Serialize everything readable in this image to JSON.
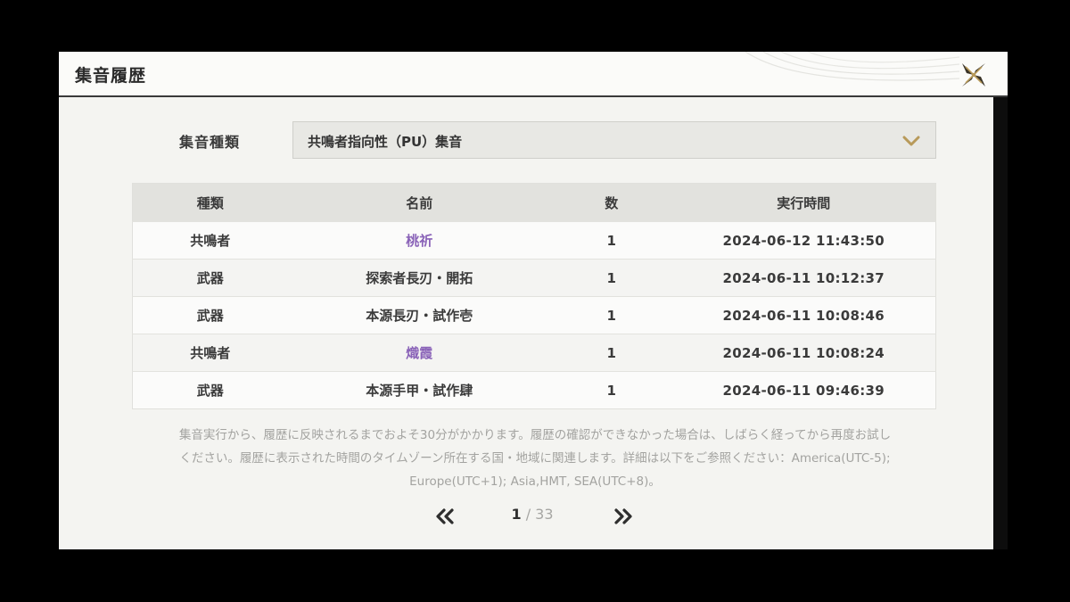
{
  "header": {
    "title": "集音履歴",
    "close_icon": "close-x-icon"
  },
  "filter": {
    "label": "集音種類",
    "selected": "共鳴者指向性（PU）集音",
    "chevron_icon": "chevron-down-icon",
    "chevron_color": "#b89a5a"
  },
  "table": {
    "headers": {
      "type": "種類",
      "name": "名前",
      "count": "数",
      "time": "実行時間"
    },
    "rows": [
      {
        "type": "共鳴者",
        "name": "桃祈",
        "count": "1",
        "time": "2024-06-12 11:43:50",
        "highlight": true
      },
      {
        "type": "武器",
        "name": "探索者長刃・開拓",
        "count": "1",
        "time": "2024-06-11 10:12:37",
        "highlight": false
      },
      {
        "type": "武器",
        "name": "本源長刃・試作壱",
        "count": "1",
        "time": "2024-06-11 10:08:46",
        "highlight": false
      },
      {
        "type": "共鳴者",
        "name": "熾霞",
        "count": "1",
        "time": "2024-06-11 10:08:24",
        "highlight": true
      },
      {
        "type": "武器",
        "name": "本源手甲・試作肆",
        "count": "1",
        "time": "2024-06-11 09:46:39",
        "highlight": false
      }
    ],
    "highlight_color": "#8a63b8"
  },
  "notice": {
    "line1": "集音実行から、履歴に反映されるまでおよそ30分がかかります。履歴の確認ができなかった場合は、しばらく経ってから再度お試し",
    "line2": "ください。履歴に表示された時間のタイムゾーン所在する国・地域に関連します。詳細は以下をご参照ください：America(UTC-5);",
    "line3": "Europe(UTC+1); Asia,HMT, SEA(UTC+8)。"
  },
  "pager": {
    "current": "1",
    "separator": " / ",
    "total": "33",
    "prev_icon": "double-chevron-left-icon",
    "next_icon": "double-chevron-right-icon"
  }
}
